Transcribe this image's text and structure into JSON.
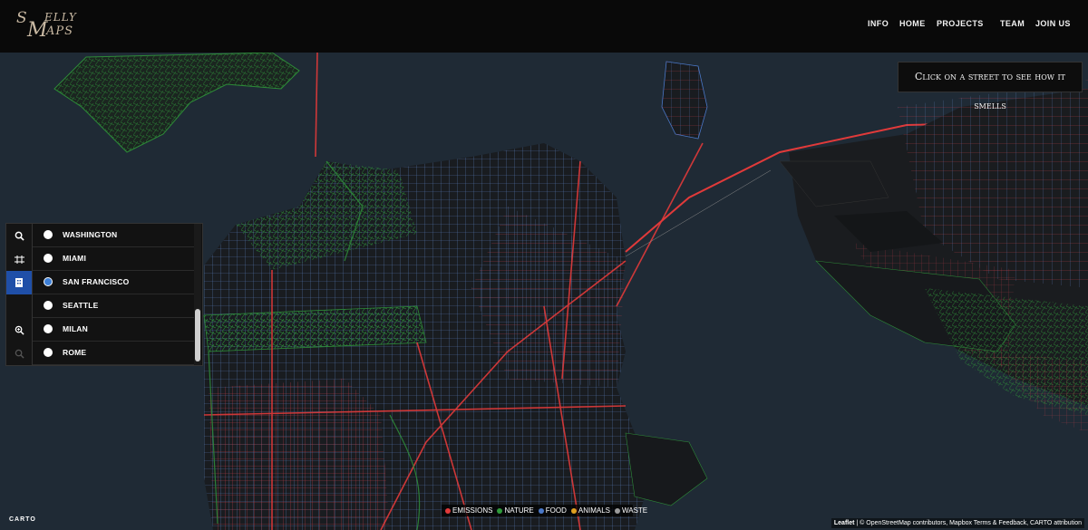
{
  "header": {
    "logo_s": "S",
    "logo_m": "M",
    "logo_elly": "ELLY",
    "logo_aps": "APS",
    "nav": [
      "INFO",
      "HOME",
      "PROJECTS",
      "TEAM",
      "JOIN US"
    ]
  },
  "map": {
    "hint": "Click on a street to see how it smells",
    "colors": {
      "water": "#1f2a35",
      "land": "#1a1c1f",
      "emissions": "#e13a3a",
      "nature": "#2f9a3a",
      "food": "#4a78c8",
      "animals": "#e0a020",
      "waste": "#9a9a9a"
    }
  },
  "city_panel": {
    "tools": [
      "search-icon",
      "frame-icon",
      "building-icon",
      "blank",
      "zoom-in-icon",
      "zoom-out-icon"
    ],
    "active_tool": 2,
    "cities": [
      "WASHINGTON",
      "MIAMI",
      "SAN FRANCISCO",
      "SEATTLE",
      "MILAN",
      "ROME"
    ],
    "selected_city": "SAN FRANCISCO"
  },
  "legend": [
    {
      "label": "EMISSIONS",
      "color": "#e13a3a"
    },
    {
      "label": "NATURE",
      "color": "#2f9a3a"
    },
    {
      "label": "FOOD",
      "color": "#4a78c8"
    },
    {
      "label": "ANIMALS",
      "color": "#e0a020"
    },
    {
      "label": "WASTE",
      "color": "#9a9a9a"
    }
  ],
  "attribution": {
    "leaflet": "Leaflet",
    "rest": " | © OpenStreetMap contributors, Mapbox Terms & Feedback, CARTO attribution"
  },
  "carto_logo": "CARTO"
}
